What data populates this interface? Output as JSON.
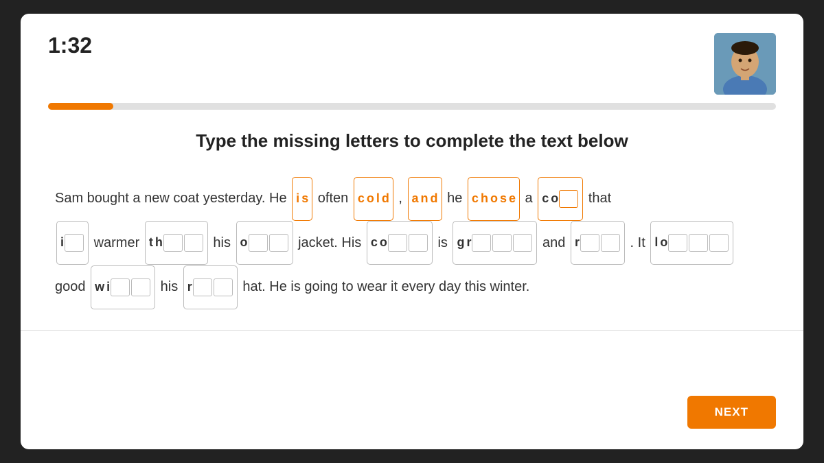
{
  "timer": "1:32",
  "progress": {
    "percent": 9,
    "color": "#f07800"
  },
  "instruction": "Type the missing letters to complete the text below",
  "next_button": "NEXT",
  "sentence": {
    "line1_prefix": "Sam bought a new coat yesterday. He",
    "line1_suffix": "that",
    "line2_prefix": "warmer",
    "line2_middle1": "his",
    "line2_middle2": "jacket. His",
    "line2_middle3": "is",
    "line2_middle4": "and",
    "line2_suffix": ". It",
    "line3_prefix": "good",
    "line3_middle": "his",
    "line3_suffix": "hat. He is going to wear it every day this winter."
  }
}
